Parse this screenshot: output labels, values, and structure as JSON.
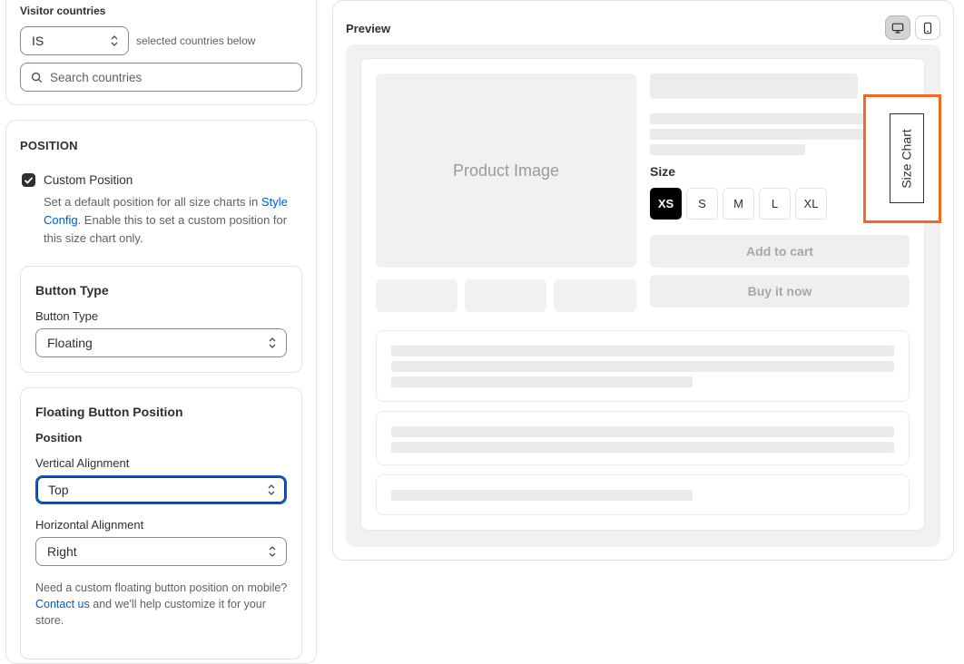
{
  "visitor": {
    "label": "Visitor countries",
    "mode_value": "IS",
    "mode_suffix": "selected countries below",
    "search_placeholder": "Search countries"
  },
  "position": {
    "section_title": "POSITION",
    "custom_checkbox_label": "Custom Position",
    "custom_checked": true,
    "help_pre": "Set a default position for all size charts in ",
    "help_link": "Style Config",
    "help_post": ". Enable this to set a custom position for this size chart only.",
    "button_type": {
      "title": "Button Type",
      "field_label": "Button Type",
      "value": "Floating"
    },
    "floating": {
      "title": "Floating Button Position",
      "subtitle": "Position",
      "vertical_label": "Vertical Alignment",
      "vertical_value": "Top",
      "horizontal_label": "Horizontal Alignment",
      "horizontal_value": "Right",
      "help_pre": "Need a custom floating button position on mobile? ",
      "help_link": "Contact us",
      "help_post": " and we'll help customize it for your store."
    }
  },
  "preview": {
    "title": "Preview",
    "device_desktop_icon": "desktop-icon",
    "device_mobile_icon": "mobile-icon",
    "product_image_label": "Product Image",
    "size_label": "Size",
    "sizes": [
      "XS",
      "S",
      "M",
      "L",
      "XL"
    ],
    "selected_size": "XS",
    "add_to_cart": "Add to cart",
    "buy_now": "Buy it now",
    "floating_button_label": "Size Chart",
    "highlight_color": "#f26a21"
  }
}
